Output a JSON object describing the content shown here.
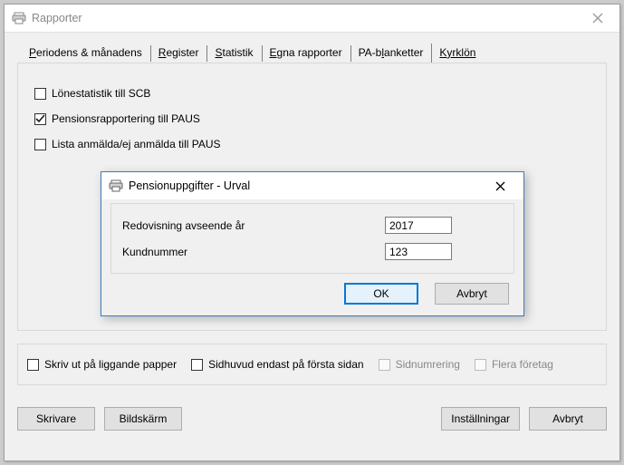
{
  "window": {
    "title": "Rapporter",
    "close_icon": "×"
  },
  "tabs": {
    "periodens": {
      "prefix": "P",
      "rest": "eriodens & månadens"
    },
    "register": {
      "prefix": "R",
      "rest": "egister"
    },
    "statistik": {
      "prefix": "S",
      "rest": "tatistik"
    },
    "egna": {
      "prefix": "E",
      "rest": "gna rapporter"
    },
    "pa": {
      "prefix": "PA-b",
      "acc_char": "l",
      "suffix": "anketter"
    },
    "kyrklon": {
      "prefix": "K",
      "rest": "yrklön"
    }
  },
  "panel": {
    "opt1": "Lönestatistik till SCB",
    "opt2": "Pensionsrapportering till PAUS",
    "opt3": "Lista anmälda/ej anmälda till PAUS"
  },
  "footer": {
    "opt_liggande": "Skriv ut på liggande papper",
    "opt_sidhuvud": "Sidhuvud endast på första sidan",
    "opt_sidnum": "Sidnumrering",
    "opt_flera": "Flera företag"
  },
  "buttons": {
    "skrivare": "Skrivare",
    "bildskarm": "Bildskärm",
    "installningar": "Inställningar",
    "avbryt": "Avbryt"
  },
  "dialog": {
    "title": "Pensionuppgifter - Urval",
    "close_icon": "✕",
    "field_year_label": "Redovisning avseende år",
    "field_year_value": "2017",
    "field_kund_label": "Kundnummer",
    "field_kund_value": "123",
    "ok": "OK",
    "avbryt": "Avbryt"
  }
}
